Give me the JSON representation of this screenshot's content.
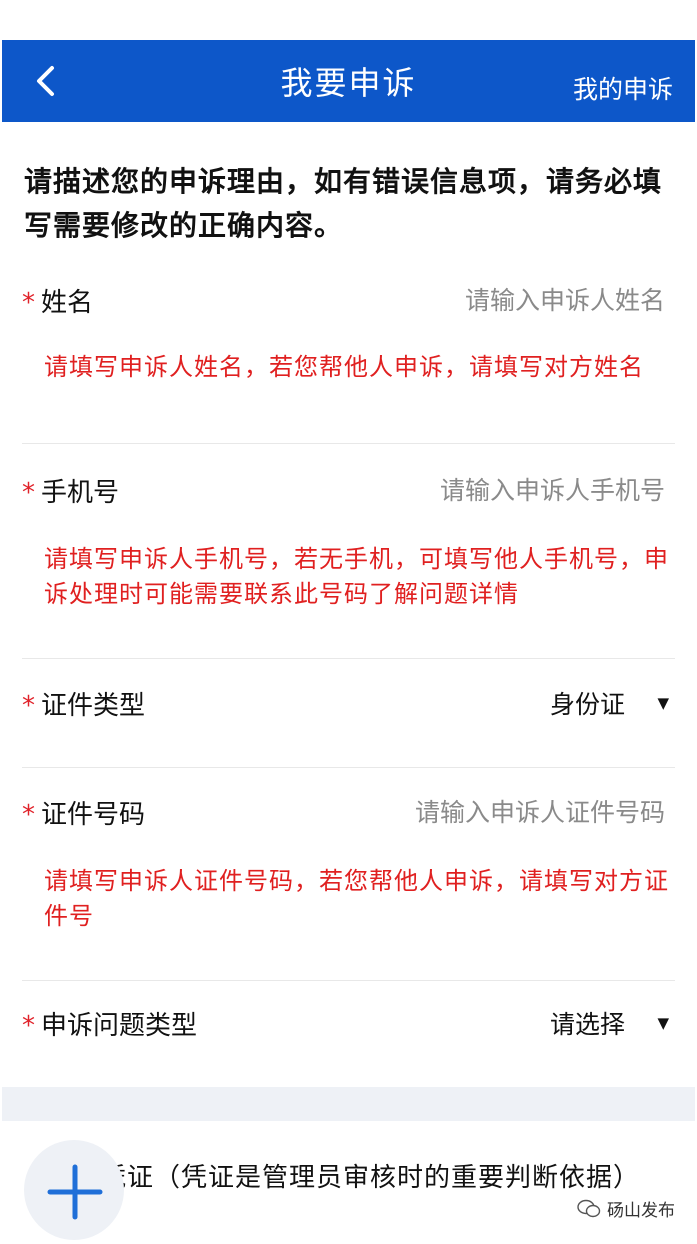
{
  "header": {
    "title": "我要申诉",
    "right_link": "我的申诉",
    "bg_color": "#0d57c9"
  },
  "description": "请描述您的申诉理由，如有错误信息项，请务必填写需要修改的正确内容。",
  "fields": [
    {
      "label": "姓名",
      "placeholder": "请输入申诉人姓名",
      "hint": "请填写申诉人姓名，若您帮他人申诉，请填写对方姓名"
    },
    {
      "label": "手机号",
      "placeholder": "请输入申诉人手机号",
      "hint": "请填写申诉人手机号，若无手机，可填写他人手机号，申诉处理时可能需要联系此号码了解问题详情"
    },
    {
      "label": "证件类型",
      "value": "身份证"
    },
    {
      "label": "证件号码",
      "placeholder": "请输入申诉人证件号码",
      "hint": "请填写申诉人证件号码，若您帮他人申诉，请填写对方证件号"
    },
    {
      "label": "申诉问题类型",
      "value": "请选择"
    }
  ],
  "required_mark": "*",
  "caret": "▼",
  "upload": {
    "title": "上传凭证（凭证是管理员审核时的重要判断依据）"
  },
  "watermark": "砀山发布",
  "icons": [
    "back-arrow-icon",
    "plus-icon",
    "wechat-icon",
    "chevron-down-icon"
  ],
  "colors": {
    "accent": "#0d57c9",
    "required": "#e0222a",
    "hint": "#e02020",
    "band": "#eef1f6"
  }
}
